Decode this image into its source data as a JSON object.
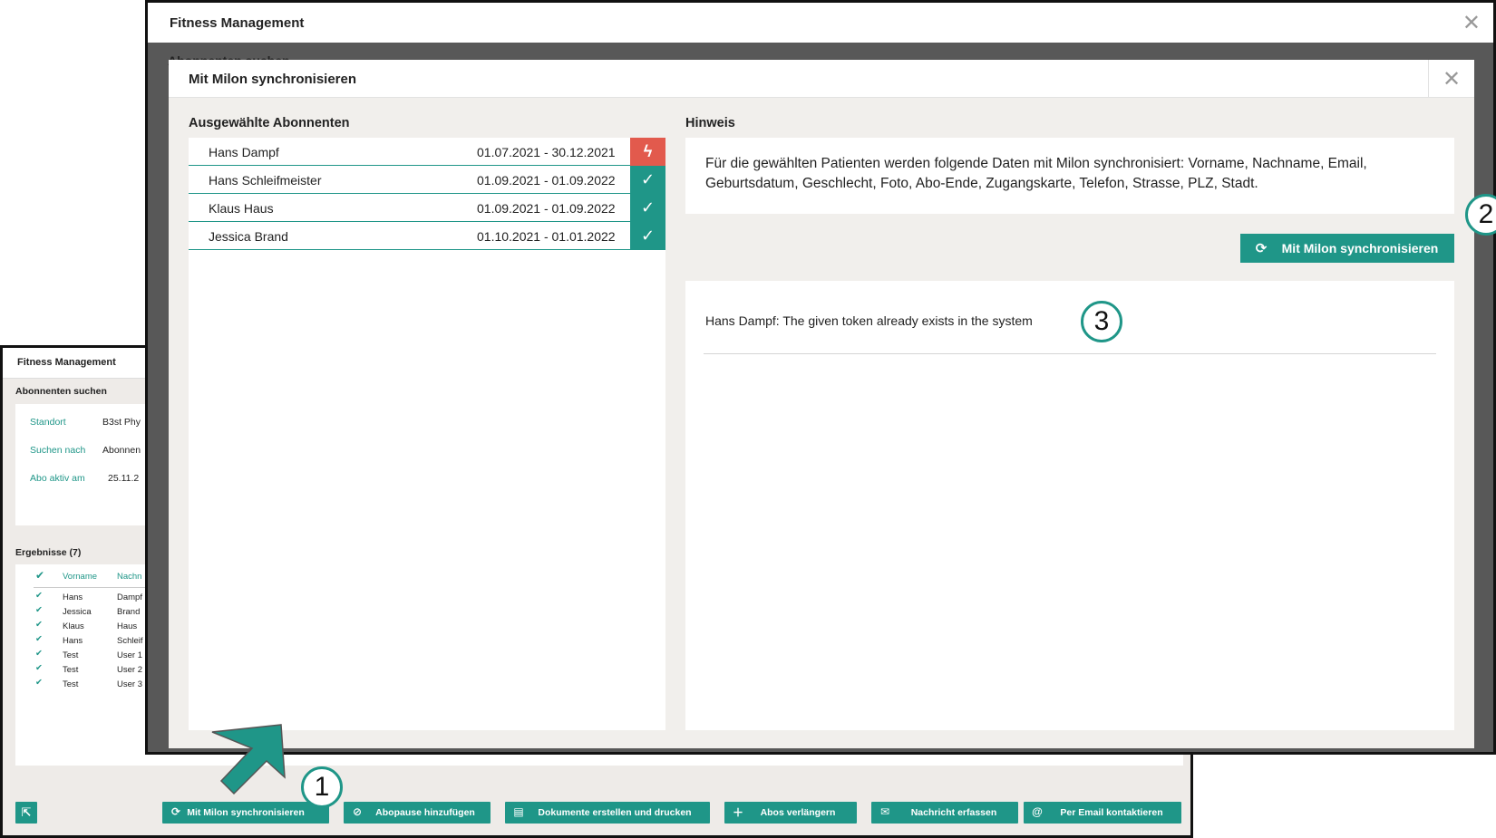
{
  "background_window": {
    "title": "Fitness Management",
    "search_section": "Abonnenten suchen",
    "fields": [
      {
        "label": "Standort",
        "value": "B3st Phy"
      },
      {
        "label": "Suchen nach",
        "value": "Abonnen"
      },
      {
        "label": "Abo aktiv am",
        "value": "25.11.2"
      }
    ],
    "results_heading": "Ergebnisse (7)",
    "columns": [
      "Vorname",
      "Nachn"
    ],
    "rows": [
      {
        "first": "Hans",
        "last": "Dampf"
      },
      {
        "first": "Jessica",
        "last": "Brand"
      },
      {
        "first": "Klaus",
        "last": "Haus"
      },
      {
        "first": "Hans",
        "last": "Schleif"
      },
      {
        "first": "Test",
        "last": "User 1"
      },
      {
        "first": "Test",
        "last": "User 2"
      },
      {
        "first": "Test",
        "last": "User 3"
      }
    ],
    "buttons": [
      {
        "label": "Mit Milon synchronisieren",
        "icon": "sync-icon"
      },
      {
        "label": "Abopause hinzufügen",
        "icon": "pause-icon"
      },
      {
        "label": "Dokumente erstellen und drucken",
        "icon": "printer-icon"
      },
      {
        "label": "Abos verlängern",
        "icon": "plus-icon"
      },
      {
        "label": "Nachricht erfassen",
        "icon": "envelope-icon"
      },
      {
        "label": "Per Email kontaktieren",
        "icon": "at-icon"
      }
    ]
  },
  "main_window": {
    "title": "Fitness Management",
    "partial_label": "Abonnenten suchen"
  },
  "modal": {
    "title": "Mit Milon synchronisieren",
    "selected_heading": "Ausgewählte Abonnenten",
    "subscribers": [
      {
        "name": "Hans Dampf",
        "period": "01.07.2021 - 30.12.2021",
        "status": "error"
      },
      {
        "name": "Hans Schleifmeister",
        "period": "01.09.2021 - 01.09.2022",
        "status": "ok"
      },
      {
        "name": "Klaus Haus",
        "period": "01.09.2021 - 01.09.2022",
        "status": "ok"
      },
      {
        "name": "Jessica Brand",
        "period": "01.10.2021 - 01.01.2022",
        "status": "ok"
      }
    ],
    "hint_heading": "Hinweis",
    "hint_text": "Für die gewählten Patienten werden folgende Daten mit Milon synchronisiert: Vorname, Nachname, Email, Geburtsdatum, Geschlecht, Foto, Abo-Ende, Zugangskarte, Telefon, Strasse, PLZ, Stadt.",
    "sync_button": "Mit Milon synchronisieren",
    "log_message": "Hans Dampf: The given token already exists in the system"
  },
  "annotations": {
    "step1": "1",
    "step2": "2",
    "step3": "3"
  },
  "colors": {
    "accent": "#1f9688",
    "error": "#e25a4d",
    "modal_bg": "#f1efec"
  }
}
